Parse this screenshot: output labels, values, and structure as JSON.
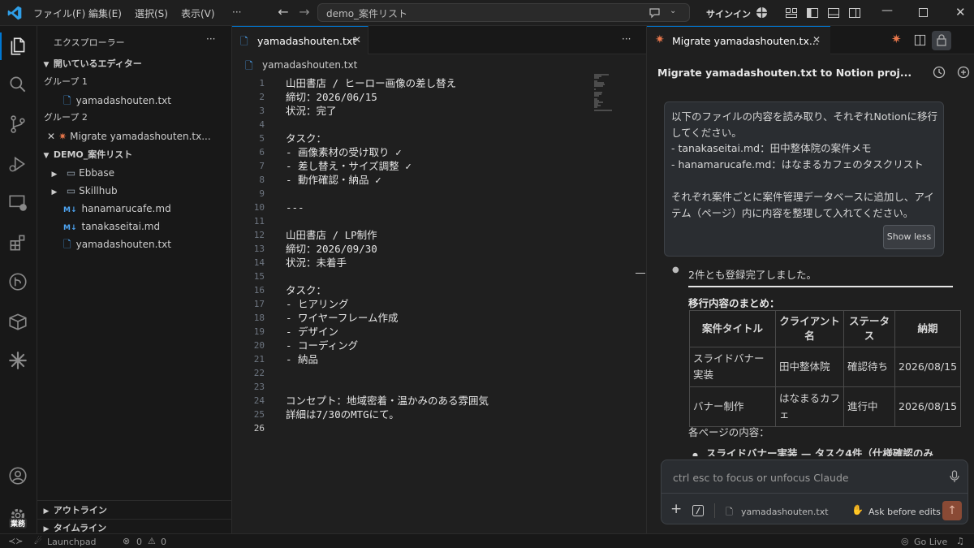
{
  "titlebar": {
    "menus": [
      "ファイル(F)",
      "編集(E)",
      "選択(S)",
      "表示(V)",
      "···"
    ],
    "search_text": "demo_案件リスト",
    "signin": "サインイン"
  },
  "activity": {
    "badge": "業務"
  },
  "sidebar": {
    "title": "エクスプローラー",
    "open_editors": "開いているエディター",
    "group1": "グループ 1",
    "group1_file": "yamadashouten.txt",
    "group2": "グループ 2",
    "group2_item": "Migrate yamadashouten.tx...",
    "folder": "DEMO_案件リスト",
    "items": [
      "Ebbase",
      "Skillhub",
      "hanamarucafe.md",
      "tanakaseitai.md",
      "yamadashouten.txt"
    ],
    "outline": "アウトライン",
    "timeline": "タイムライン"
  },
  "editor": {
    "tab": "yamadashouten.txt",
    "breadcrumb": "yamadashouten.txt",
    "lines": [
      "山田書店 / ヒーロー画像の差し替え",
      "締切：2026/06/15",
      "状況：完了",
      "",
      "タスク：",
      "- 画像素材の受け取り ✓",
      "- 差し替え・サイズ調整 ✓",
      "- 動作確認・納品 ✓",
      "",
      "---",
      "",
      "山田書店 / LP制作",
      "締切：2026/09/30",
      "状況：未着手",
      "",
      "タスク：",
      "- ヒアリング",
      "- ワイヤーフレーム作成",
      "- デザイン",
      "- コーディング",
      "- 納品",
      "",
      "",
      "コンセプト：地域密着・温かみのある雰囲気",
      "詳細は7/30のMTGにて。",
      ""
    ],
    "line_numbers": [
      "1",
      "2",
      "3",
      "4",
      "5",
      "6",
      "7",
      "8",
      "9",
      "10",
      "11",
      "12",
      "13",
      "14",
      "15",
      "16",
      "17",
      "18",
      "19",
      "20",
      "21",
      "22",
      "23",
      "24",
      "25",
      "26"
    ]
  },
  "panel": {
    "tab": "Migrate yamadashouten.tx...",
    "title": "Migrate yamadashouten.txt to Notion proj...",
    "message_lines": [
      "以下のファイルの内容を読み取り、それぞれNotionに移行",
      "してください。",
      "- tanakaseitai.md：田中整体院の案件メモ",
      "- hanamarucafe.md：はなまるカフェのタスクリスト",
      "",
      "それぞれ案件ごとに案件管理データベースに追加し、アイ",
      "テム（ページ）内に内容を整理して入れてください。"
    ],
    "show_less": "Show less",
    "result_intro": "2件とも登録完了しました。",
    "summary_title": "移行内容のまとめ：",
    "table_headers": [
      "案件タイトル",
      "クライアント名",
      "ステータス",
      "納期"
    ],
    "table_rows": [
      [
        "スライドバナー実装",
        "田中整体院",
        "確認待ち",
        "2026/08/15"
      ],
      [
        "バナー制作",
        "はなまるカフェ",
        "進行中",
        "2026/08/15"
      ]
    ],
    "page_contents": "各ページの内容：",
    "bullet_partial": "スライドバナー実装 — タスク4件（仕様確認のみ",
    "input_placeholder": "ctrl esc to focus or unfocus Claude",
    "attached_file": "yamadashouten.txt",
    "mode": "Ask before edits"
  },
  "statusbar": {
    "launchpad": "Launchpad",
    "errors": "0",
    "warnings": "0",
    "golive": "Go Live"
  }
}
